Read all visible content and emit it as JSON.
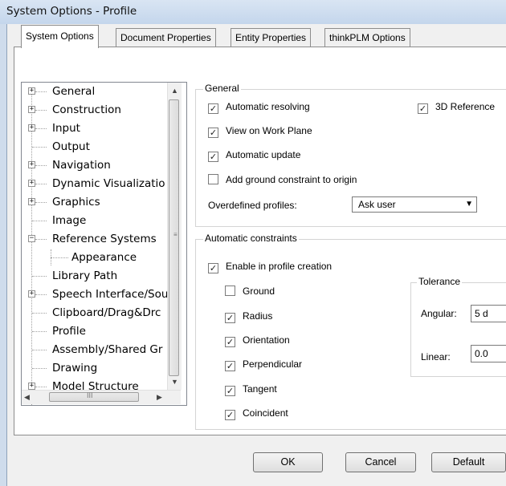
{
  "window": {
    "title": "System Options - Profile"
  },
  "tabs": [
    {
      "label": "System Options",
      "active": true
    },
    {
      "label": "Document Properties",
      "active": false
    },
    {
      "label": "Entity Properties",
      "active": false
    },
    {
      "label": "thinkPLM Options",
      "active": false
    }
  ],
  "tree": {
    "items": [
      {
        "label": "General",
        "expander": "+"
      },
      {
        "label": "Construction",
        "expander": "+"
      },
      {
        "label": "Input",
        "expander": "+"
      },
      {
        "label": "Output",
        "expander": ""
      },
      {
        "label": "Navigation",
        "expander": "+"
      },
      {
        "label": "Dynamic Visualizatio",
        "expander": "+"
      },
      {
        "label": "Graphics",
        "expander": "+"
      },
      {
        "label": "Image",
        "expander": ""
      },
      {
        "label": "Reference Systems",
        "expander": "−"
      },
      {
        "label": "Appearance",
        "expander": ""
      },
      {
        "label": "Library Path",
        "expander": ""
      },
      {
        "label": "Speech Interface/Sou",
        "expander": "+"
      },
      {
        "label": "Clipboard/Drag&Drc",
        "expander": ""
      },
      {
        "label": "Profile",
        "expander": ""
      },
      {
        "label": "Assembly/Shared Gr",
        "expander": ""
      },
      {
        "label": "Drawing",
        "expander": ""
      },
      {
        "label": "Model Structure",
        "expander": "+"
      }
    ],
    "selected": "Profile",
    "scroll_arrows": {
      "up": "▲",
      "down": "▼",
      "left": "◀",
      "right": "▶"
    },
    "grip_glyph": "≡",
    "hgrip_glyph": "III"
  },
  "general_group": {
    "title": "General",
    "automatic_resolving": {
      "label": "Automatic resolving",
      "checked": true
    },
    "reference_3d": {
      "label": "3D Reference",
      "checked": true
    },
    "view_on_work_plane": {
      "label": "View on Work Plane",
      "checked": true
    },
    "automatic_update": {
      "label": "Automatic update",
      "checked": true
    },
    "add_ground_constraint": {
      "label": "Add ground constraint to origin",
      "checked": false
    },
    "overdefined_label": "Overdefined profiles:",
    "overdefined_value": "Ask user",
    "dropdown_arrow": "▼"
  },
  "constraints_group": {
    "title": "Automatic constraints",
    "enable": {
      "label": "Enable in profile creation",
      "checked": true
    },
    "items": [
      {
        "label": "Ground",
        "checked": false
      },
      {
        "label": "Radius",
        "checked": true
      },
      {
        "label": "Orientation",
        "checked": true
      },
      {
        "label": "Perpendicular",
        "checked": true
      },
      {
        "label": "Tangent",
        "checked": true
      },
      {
        "label": "Coincident",
        "checked": true
      }
    ],
    "tolerance": {
      "title": "Tolerance",
      "angular_label": "Angular:",
      "angular_value": "5 d",
      "linear_label": "Linear:",
      "linear_value": "0.0"
    }
  },
  "buttons": {
    "ok": "OK",
    "cancel": "Cancel",
    "default": "Default"
  },
  "check_glyph": "✓"
}
